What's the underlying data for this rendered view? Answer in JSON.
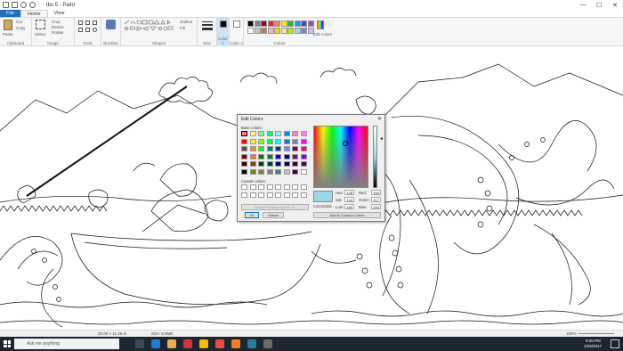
{
  "window": {
    "title": "tbs 5 - Paint",
    "controls": [
      "—",
      "☐",
      "✕"
    ]
  },
  "menu": {
    "file": "File",
    "home": "Home",
    "view": "View"
  },
  "ribbon": {
    "clipboard": {
      "label": "Clipboard",
      "paste": "Paste",
      "cut": "Cut",
      "copy": "Copy"
    },
    "image": {
      "label": "Image",
      "select": "Select",
      "crop": "Crop",
      "resize": "Resize",
      "rotate": "Rotate"
    },
    "tools": {
      "label": "Tools"
    },
    "brushes": {
      "label": "Brushes"
    },
    "shapes": {
      "label": "Shapes",
      "outline": "Outline",
      "fill": "Fill"
    },
    "size": {
      "label": "Size"
    },
    "color1": {
      "label": "Color 1"
    },
    "color2": {
      "label": "Color 2"
    },
    "colors": {
      "label": "Colors",
      "edit_label": "Edit colors"
    },
    "palette": [
      "#000000",
      "#7f7f7f",
      "#880015",
      "#ed1c24",
      "#ff7f27",
      "#fff200",
      "#22b14c",
      "#00a2e8",
      "#3f48cc",
      "#a349a4",
      "#ffffff",
      "#c3c3c3",
      "#b97a57",
      "#ffaec9",
      "#ffc90e",
      "#efe4b0",
      "#b5e61d",
      "#99d9ea",
      "#7092be",
      "#c8bfe7"
    ]
  },
  "dialog": {
    "title": "Edit Colors",
    "close": "✕",
    "basic_colors_label": "Basic colors:",
    "custom_colors_label": "Custom colors:",
    "define_button": "Define Custom Colors >>",
    "ok": "OK",
    "cancel": "Cancel",
    "color_solid_label": "Color|Solid",
    "hue_label": "Hue:",
    "hue": "128",
    "sat_label": "Sat:",
    "sat": "116",
    "lum_label": "Lum:",
    "lum": "180",
    "red_label": "Red:",
    "red": "153",
    "green_label": "Green:",
    "green": "217",
    "blue_label": "Blue:",
    "blue": "234",
    "add_button": "Add to Custom Colors",
    "selected_color": "#99d9ea",
    "basic_colors": [
      "#ff8080",
      "#ffff80",
      "#80ff80",
      "#00ff80",
      "#80ffff",
      "#0080ff",
      "#ff80c0",
      "#ff80ff",
      "#ff0000",
      "#ffff00",
      "#80ff00",
      "#00ff40",
      "#00ffff",
      "#0080c0",
      "#8080c0",
      "#ff00ff",
      "#804040",
      "#ff8040",
      "#00ff00",
      "#008080",
      "#004080",
      "#8080ff",
      "#800040",
      "#ff0080",
      "#800000",
      "#ff8000",
      "#008000",
      "#008040",
      "#0000ff",
      "#0000a0",
      "#800080",
      "#8000ff",
      "#400000",
      "#804000",
      "#004000",
      "#004040",
      "#000080",
      "#000040",
      "#400040",
      "#400080",
      "#000000",
      "#808000",
      "#808040",
      "#808080",
      "#408080",
      "#c0c0c0",
      "#400040",
      "#ffffff"
    ]
  },
  "status": {
    "position": "20.00 × 11.25 in",
    "size": "Size: 5.9MB",
    "zoom": "100%"
  },
  "taskbar": {
    "search_placeholder": "Ask me anything",
    "time": "9:25 PM",
    "date": "1/26/2017"
  }
}
